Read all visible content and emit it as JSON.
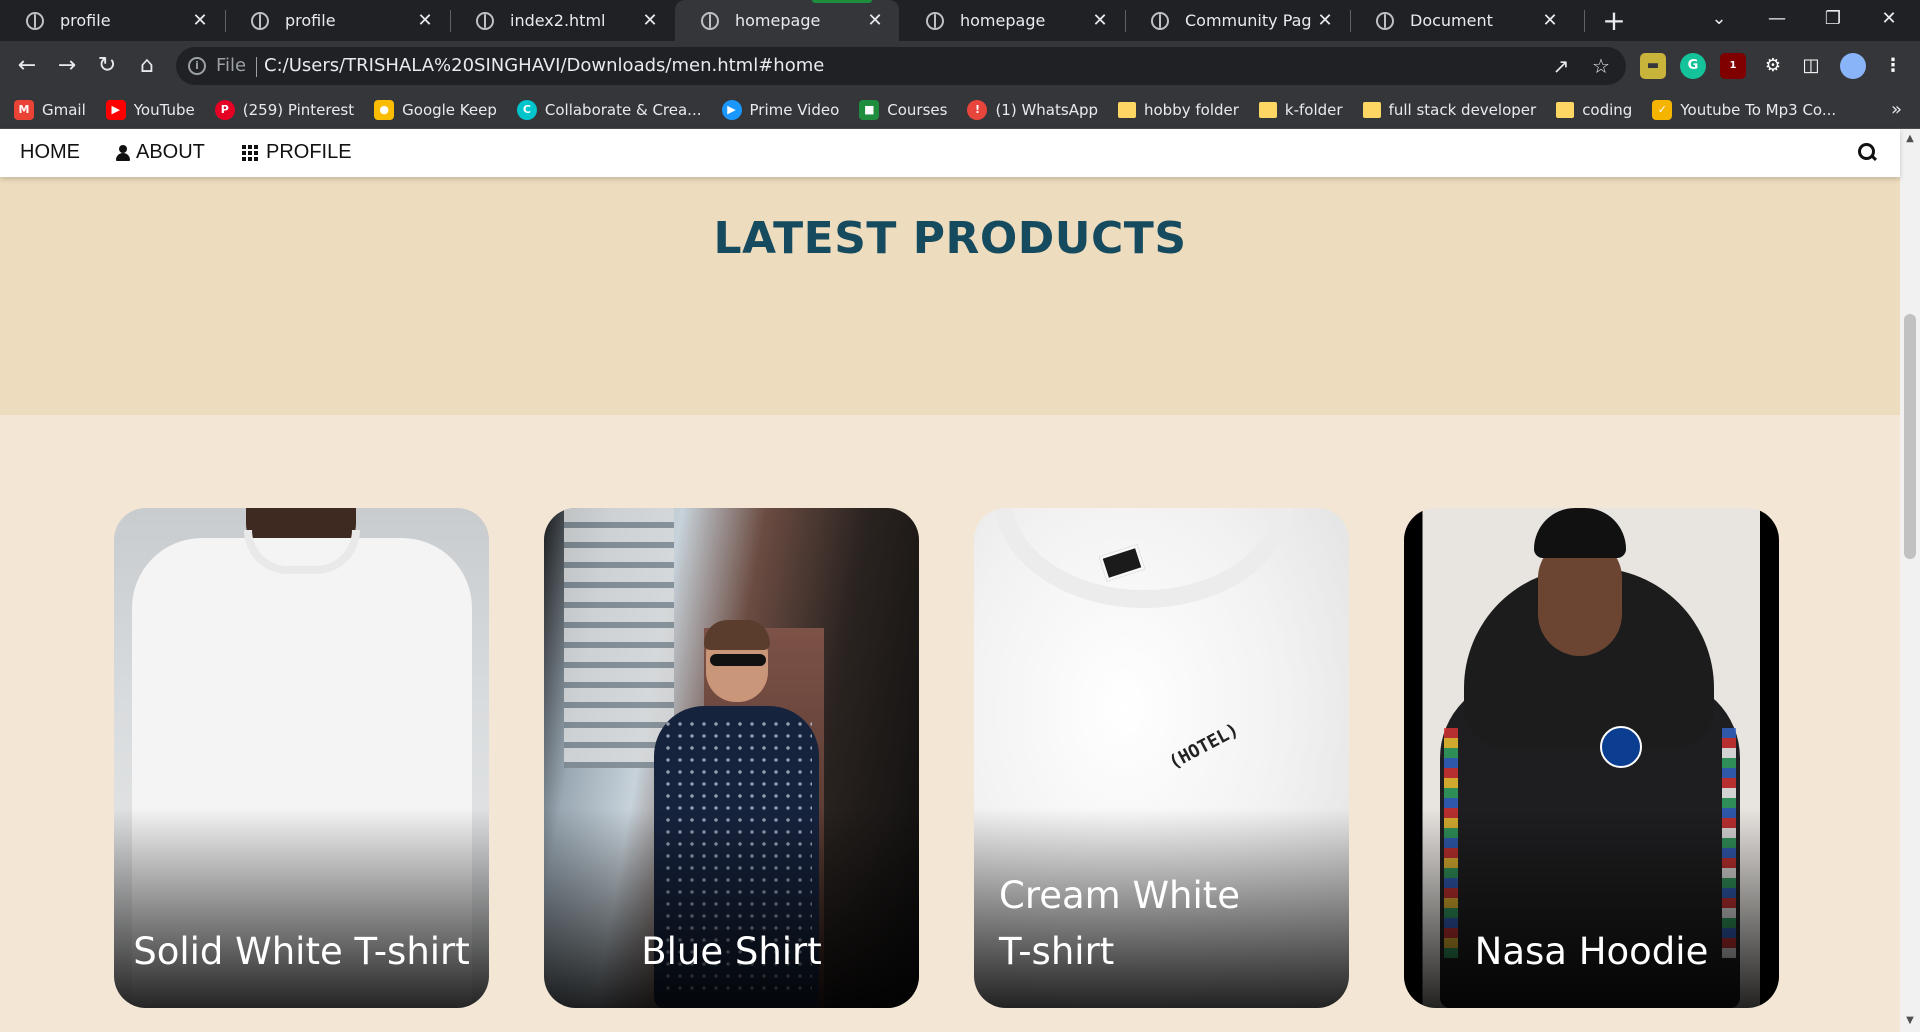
{
  "browser": {
    "tabs": [
      {
        "title": "profile",
        "close": "✕"
      },
      {
        "title": "profile",
        "close": "✕"
      },
      {
        "title": "index2.html",
        "close": "✕"
      },
      {
        "title": "homepage",
        "close": "✕"
      },
      {
        "title": "homepage",
        "close": "✕"
      },
      {
        "title": "Community Page",
        "close": "✕"
      },
      {
        "title": "Document",
        "close": "✕"
      }
    ],
    "active_tab_index": 3,
    "new_tab": "+",
    "address": {
      "scheme_label": "File",
      "url": "C:/Users/TRISHALA%20SINGHAVI/Downloads/men.html#home"
    },
    "extension_badge": "1",
    "bookmarks": [
      {
        "label": "Gmail",
        "icon": "gmail-icon",
        "color": "#ea4335"
      },
      {
        "label": "YouTube",
        "icon": "youtube-icon",
        "color": "#ff0000"
      },
      {
        "label": "(259) Pinterest",
        "icon": "pinterest-icon",
        "color": "#e60023"
      },
      {
        "label": "Google Keep",
        "icon": "keep-icon",
        "color": "#fbbc04"
      },
      {
        "label": "Collaborate & Crea...",
        "icon": "canva-icon",
        "color": "#00c4cc"
      },
      {
        "label": "Prime Video",
        "icon": "prime-video-icon",
        "color": "#1a98ff"
      },
      {
        "label": "Courses",
        "icon": "classroom-icon",
        "color": "#1e8e3e"
      },
      {
        "label": "(1) WhatsApp",
        "icon": "whatsapp-icon",
        "color": "#e8453c"
      },
      {
        "label": "hobby folder",
        "icon": "folder-icon",
        "color": "#fdd663"
      },
      {
        "label": "k-folder",
        "icon": "folder-icon",
        "color": "#fdd663"
      },
      {
        "label": "full stack developer",
        "icon": "folder-icon",
        "color": "#fdd663"
      },
      {
        "label": "coding",
        "icon": "folder-icon",
        "color": "#fdd663"
      },
      {
        "label": "Youtube To Mp3 Co...",
        "icon": "converter-icon",
        "color": "#f4b400"
      }
    ],
    "bookmarks_overflow": "»"
  },
  "site": {
    "nav": {
      "home": "HOME",
      "about": "ABOUT",
      "profile": "PROFILE"
    },
    "banner_title": "LATEST PRODUCTS",
    "products": [
      {
        "name": "Solid White T-shirt"
      },
      {
        "name": "Blue Shirt"
      },
      {
        "name": "Cream White T-shirt"
      },
      {
        "name": "Nasa Hoodie"
      }
    ],
    "third_card_text": "(HOTEL)",
    "colors": {
      "banner_bg": "#eddcbd",
      "page_bg": "#f3e6d4",
      "title": "#164a5e"
    }
  }
}
